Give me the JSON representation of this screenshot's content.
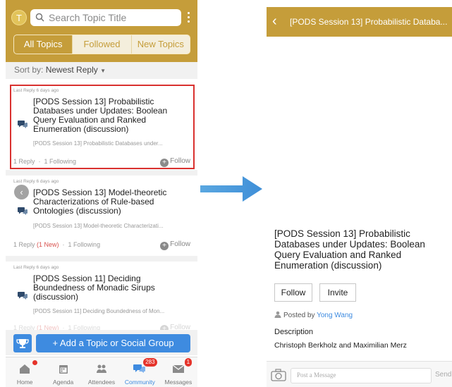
{
  "left": {
    "header": {
      "avatar_letter": "T",
      "search_placeholder": "Search Topic Title",
      "tabs": [
        {
          "label": "All Topics",
          "active": true
        },
        {
          "label": "Followed",
          "active": false
        },
        {
          "label": "New Topics",
          "active": false
        }
      ]
    },
    "sort": {
      "prefix": "Sort by:",
      "value": "Newest Reply"
    },
    "topics": [
      {
        "meta": "Last Reply 6 days ago",
        "title": "[PODS Session 13] Probabilistic Databases under Updates: Boolean Query Evaluation and Ranked Enumeration (discussion)",
        "preview": "[PODS Session 13] Probabilistic Databases under...",
        "replies": "1 Reply",
        "new": "",
        "following": "1 Following",
        "follow_label": "Follow"
      },
      {
        "meta": "Last Reply 6 days ago",
        "title": "[PODS Session 13] Model-theoretic Characterizations of Rule-based Ontologies (discussion)",
        "preview": "[PODS Session 13] Model-theoretic Characterizati...",
        "replies": "1 Reply",
        "new": "(1 New)",
        "following": "1 Following",
        "follow_label": "Follow"
      },
      {
        "meta": "Last Reply 6 days ago",
        "title": "[PODS Session 11] Deciding Boundedness of Monadic Sirups (discussion)",
        "preview": "[PODS Session 11] Deciding Boundedness of Mon...",
        "replies": "1 Reply",
        "new": "(1 New)",
        "following": "1 Following",
        "follow_label": "Follow"
      }
    ],
    "add_button": "+ Add a Topic or Social Group",
    "tabbar": [
      {
        "label": "Home",
        "icon": "home-icon",
        "badge": ""
      },
      {
        "label": "Agenda",
        "icon": "calendar-icon",
        "badge": ""
      },
      {
        "label": "Attendees",
        "icon": "people-icon",
        "badge": ""
      },
      {
        "label": "Community",
        "icon": "chat-bubbles-icon",
        "badge": "283"
      },
      {
        "label": "Messages",
        "icon": "envelope-icon",
        "badge": "1"
      }
    ]
  },
  "right": {
    "title": "[PODS Session 13] Probabilistic Databa...",
    "heading": "[PODS Session 13] Probabilistic Databases under Updates: Boolean Query Evaluation and Ranked Enumeration (discussion)",
    "follow_label": "Follow",
    "invite_label": "Invite",
    "posted_by_prefix": "Posted by",
    "author": "Yong Wang",
    "description_label": "Description",
    "description_text": "Christoph Berkholz and Maximilian Merz",
    "message_placeholder": "Post a Message",
    "send_label": "Send"
  },
  "colors": {
    "brand_gold": "#c59d3a",
    "accent_blue": "#3e8be0",
    "highlight_red": "#d9312f",
    "badge_red": "#e5332a"
  }
}
